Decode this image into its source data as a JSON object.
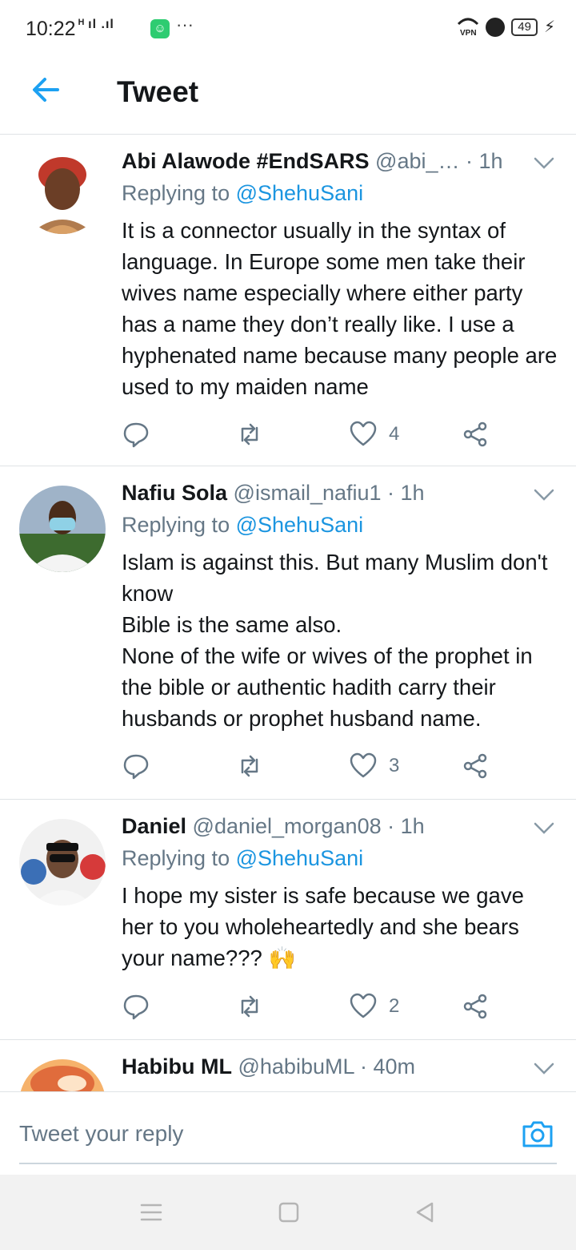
{
  "status_bar": {
    "time": "10:22",
    "signal": "ᴴ ıl .ıl",
    "app_badge": "☺",
    "more": "···",
    "vpn": "VPN",
    "battery": "49",
    "charging": "⚡"
  },
  "header": {
    "title": "Tweet",
    "back_icon": "arrow-left-icon",
    "accent": "#1da1f2"
  },
  "tweets": [
    {
      "name": "Abi Alawode #EndSARS",
      "handle_time": " @abi_… · 1h",
      "reply_prefix": "Replying to ",
      "mention": "@ShehuSani",
      "text": "It is a connector usually in the syntax of language. In Europe some men take their wives name especially where either party has a name they don’t really like. I use a hyphenated name because many people are used to my maiden name",
      "likes": "4"
    },
    {
      "name": "Nafiu Sola",
      "handle_time": " @ismail_nafiu1 · 1h",
      "reply_prefix": "Replying to ",
      "mention": "@ShehuSani",
      "text": "Islam is against this. But many Muslim don't know\nBible is the same also.\nNone of the wife or wives of the prophet in the bible or authentic hadith carry their husbands or prophet husband name.",
      "likes": "3"
    },
    {
      "name": "Daniel",
      "handle_time": " @daniel_morgan08 · 1h",
      "reply_prefix": "Replying to ",
      "mention": "@ShehuSani",
      "text": "I hope my sister is safe because we gave her to you wholeheartedly and she bears your name??? 🙌",
      "likes": "2"
    },
    {
      "name": "Habibu ML",
      "handle_time": " @habibuML · 40m"
    }
  ],
  "composer": {
    "placeholder": "Tweet your reply",
    "camera_icon": "camera-icon"
  },
  "colors": {
    "text": "#14171a",
    "secondary": "#657786",
    "link": "#1b95e0",
    "divider": "#dfe3e6"
  }
}
